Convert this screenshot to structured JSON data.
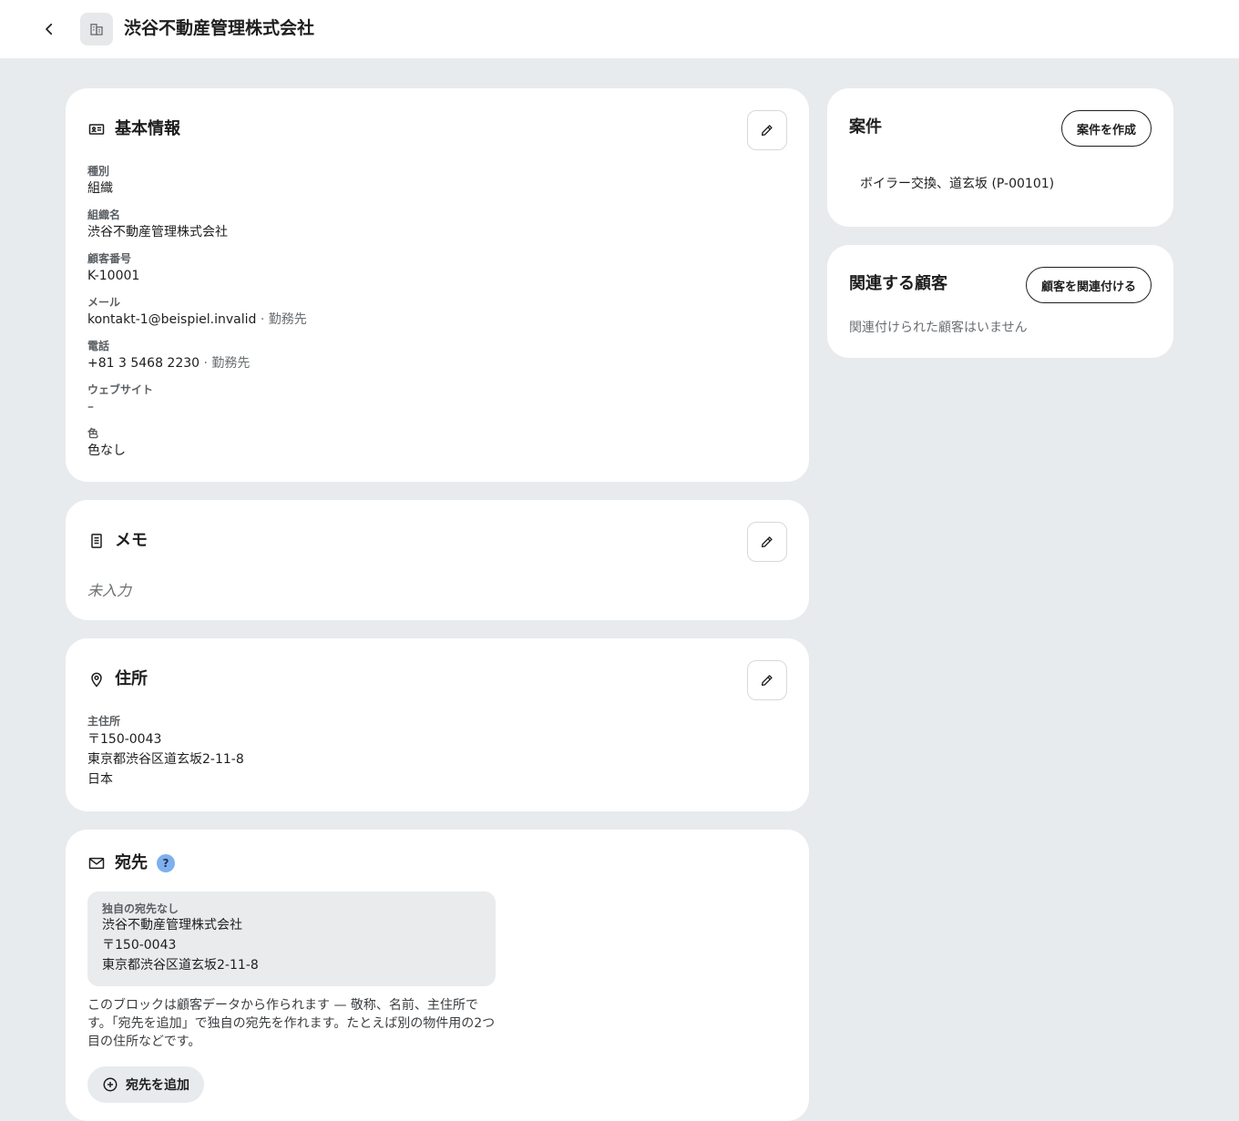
{
  "header": {
    "title": "渋谷不動産管理株式会社"
  },
  "basic_info": {
    "title": "基本情報",
    "fields": [
      {
        "label": "種別",
        "value": "組織"
      },
      {
        "label": "組織名",
        "value": "渋谷不動産管理株式会社"
      },
      {
        "label": "顧客番号",
        "value": "K-10001"
      },
      {
        "label": "メール",
        "value": "kontakt-1@beispiel.invalid",
        "suffix": " · 勤務先"
      },
      {
        "label": "電話",
        "value": "+81 3 5468 2230",
        "suffix": " · 勤務先"
      },
      {
        "label": "ウェブサイト",
        "value": "–"
      },
      {
        "label": "色",
        "value": "色なし"
      }
    ]
  },
  "memo": {
    "title": "メモ",
    "empty_text": "未入力"
  },
  "address": {
    "title": "住所",
    "label": "主住所",
    "lines": [
      "〒150-0043",
      "東京都渋谷区道玄坂2-11-8",
      "日本"
    ]
  },
  "recipient": {
    "title": "宛先",
    "help": "?",
    "box_label": "独自の宛先なし",
    "box_lines": [
      "渋谷不動産管理株式会社",
      "〒150-0043",
      "東京都渋谷区道玄坂2-11-8"
    ],
    "description_lines": [
      "このブロックは顧客データから作られます — 敬称、名前、主住所で",
      "す。「宛先を追加」で独自の宛先を作れます。たとえば別の物件用の2つ",
      "目の住所などです。"
    ],
    "add_label": "宛先を追加"
  },
  "projects": {
    "title": "案件",
    "create_label": "案件を作成",
    "items": [
      "ボイラー交換、道玄坂 (P-00101)"
    ]
  },
  "related": {
    "title": "関連する顧客",
    "link_label": "顧客を関連付ける",
    "empty_text": "関連付けられた顧客はいません"
  }
}
